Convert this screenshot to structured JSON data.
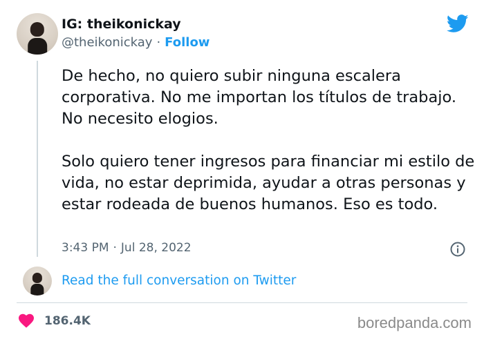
{
  "author": {
    "display_name": "IG: theikonickay",
    "handle": "@theikonickay",
    "separator": "·",
    "follow_label": "Follow"
  },
  "tweet": {
    "paragraphs": [
      "De hecho, no quiero subir ninguna escalera corporativa. No me importan los títulos de trabajo. No necesito elogios.",
      "Solo quiero tener ingresos para financiar mi estilo de vida, no estar deprimida, ayudar a otras personas y estar rodeada de buenos humanos. Eso es todo."
    ],
    "time": "3:43 PM",
    "separator": "·",
    "date": "Jul 28, 2022"
  },
  "conversation": {
    "link_label": "Read the full conversation on Twitter"
  },
  "stats": {
    "likes": "186.4K"
  },
  "watermark": "boredpanda.com",
  "icons": {
    "brand": "twitter-bird-icon",
    "info": "info-icon",
    "like": "heart-icon"
  },
  "colors": {
    "accent": "#1d9bf0",
    "heart": "#f91880",
    "text": "#0f1419",
    "muted": "#536471"
  }
}
